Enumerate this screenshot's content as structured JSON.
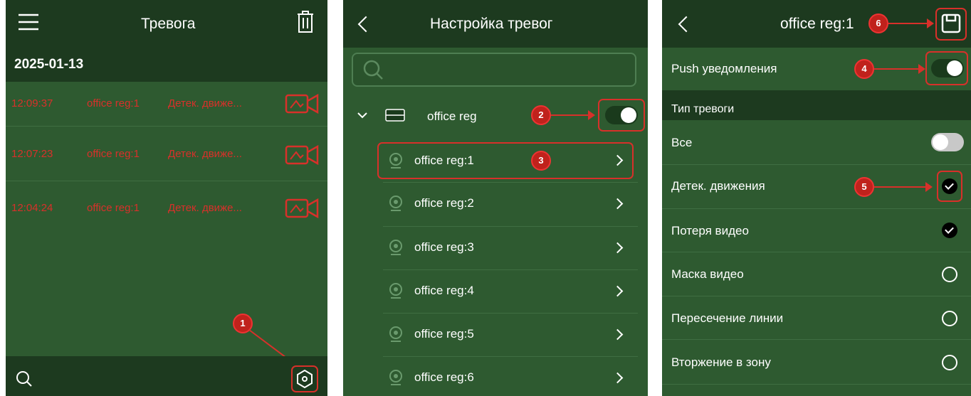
{
  "panel1": {
    "title": "Тревога",
    "date": "2025-01-13",
    "alarms": [
      {
        "time": "12:09:37",
        "device": "office reg:1",
        "type": "Детек. движе..."
      },
      {
        "time": "12:07:23",
        "device": "office reg:1",
        "type": "Детек. движе..."
      },
      {
        "time": "12:04:24",
        "device": "office reg:1",
        "type": "Детек. движе..."
      }
    ],
    "badge": "1",
    "icons": {
      "menu": "menu-icon",
      "trash": "trash-icon",
      "video": "camera-icon",
      "search": "search-icon",
      "settings": "gear-icon"
    }
  },
  "panel2": {
    "title": "Настройка тревог",
    "search_placeholder": "",
    "device": {
      "name": "office reg",
      "enabled": true
    },
    "channels": [
      "office reg:1",
      "office reg:2",
      "office reg:3",
      "office reg:4",
      "office reg:5",
      "office reg:6"
    ],
    "badges": [
      "2",
      "3"
    ]
  },
  "panel3": {
    "title": "office reg:1",
    "push_label": "Push уведомления",
    "push_enabled": true,
    "section_label": "Тип тревоги",
    "all_label": "Все",
    "all_enabled": false,
    "types": [
      {
        "label": "Детек. движения",
        "checked": true
      },
      {
        "label": "Потеря видео",
        "checked": true
      },
      {
        "label": "Маска видео",
        "checked": false
      },
      {
        "label": "Пересечение линии",
        "checked": false
      },
      {
        "label": "Вторжение в зону",
        "checked": false
      }
    ],
    "badges": [
      "6",
      "4",
      "5"
    ]
  },
  "colors": {
    "header": "#1d3a1f",
    "background": "#2e5a30",
    "alarm_red": "#d8302a",
    "annotation_red": "#c0221c"
  }
}
